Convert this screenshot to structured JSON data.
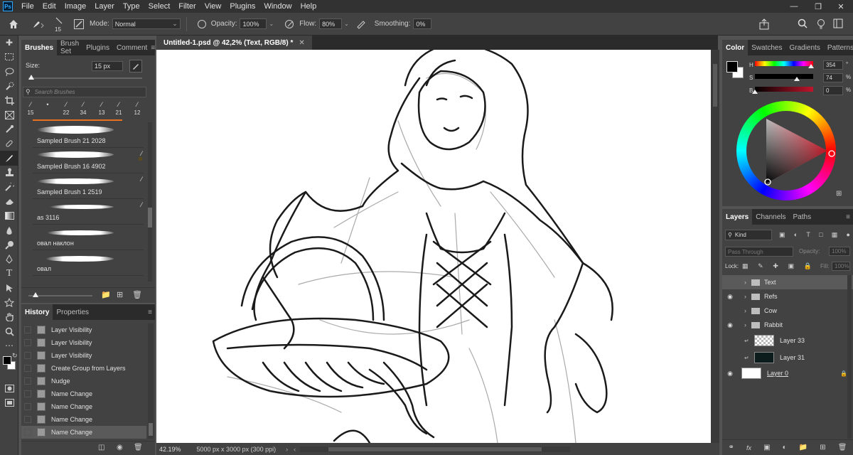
{
  "menubar": {
    "logo": "Ps",
    "items": [
      "File",
      "Edit",
      "Image",
      "Layer",
      "Type",
      "Select",
      "Filter",
      "View",
      "Plugins",
      "Window",
      "Help"
    ]
  },
  "options": {
    "brush_size": "15",
    "mode_label": "Mode:",
    "mode_value": "Normal",
    "opacity_label": "Opacity:",
    "opacity_value": "100%",
    "flow_label": "Flow:",
    "flow_value": "80%",
    "smoothing_label": "Smoothing:",
    "smoothing_value": "0%"
  },
  "brushes": {
    "tabs": [
      "Brushes",
      "Brush Set",
      "Plugins",
      "Comment"
    ],
    "size_label": "Size:",
    "size_value": "15 px",
    "search_placeholder": "Search Brushes",
    "recent_sizes": [
      "15",
      "",
      "22",
      "34",
      "13",
      "21",
      "12"
    ],
    "items": [
      {
        "name": "Sampled Brush 21 2028"
      },
      {
        "name": "Sampled Brush 16 4902"
      },
      {
        "name": "Sampled Brush 1 2519"
      },
      {
        "name": "as 3116"
      },
      {
        "name": "овал наклон"
      },
      {
        "name": "овал"
      }
    ]
  },
  "history": {
    "tabs": [
      "History",
      "Properties"
    ],
    "items": [
      "Layer Visibility",
      "Layer Visibility",
      "Layer Visibility",
      "Create Group from Layers",
      "Nudge",
      "Name Change",
      "Name Change",
      "Name Change",
      "Name Change"
    ]
  },
  "document": {
    "tab_title": "Untitled-1.psd @ 42,2% (Text, RGB/8) *",
    "zoom": "42.19%",
    "doc_info": "5000 px x 3000 px (300 ppi)"
  },
  "color": {
    "tabs": [
      "Color",
      "Swatches",
      "Gradients",
      "Patterns"
    ],
    "h_label": "H",
    "h_value": "354",
    "h_unit": "°",
    "s_label": "S",
    "s_value": "74",
    "s_unit": "%",
    "b_label": "B",
    "b_value": "0",
    "b_unit": "%",
    "foreground": "#000000",
    "background": "#ffffff"
  },
  "layers": {
    "tabs": [
      "Layers",
      "Channels",
      "Paths"
    ],
    "filter_value": "Kind",
    "blend_value": "Pass Through",
    "opacity_label": "Opacity:",
    "opacity_value": "100%",
    "lock_label": "Lock:",
    "fill_label": "Fill:",
    "fill_value": "100%",
    "items": [
      {
        "name": "Text",
        "type": "group",
        "visible": false
      },
      {
        "name": "Refs",
        "type": "group",
        "visible": true
      },
      {
        "name": "Cow",
        "type": "group",
        "visible": false
      },
      {
        "name": "Rabbit",
        "type": "group",
        "visible": true
      },
      {
        "name": "Layer 33",
        "type": "layer",
        "visible": false
      },
      {
        "name": "Layer 31",
        "type": "layer",
        "visible": false
      },
      {
        "name": "Layer 0",
        "type": "layer",
        "visible": true
      }
    ]
  },
  "colors": {
    "accent": "#31a8ff",
    "panel_bg": "#424242",
    "dark_bg": "#323232",
    "brush_selection": "#e8711f"
  }
}
